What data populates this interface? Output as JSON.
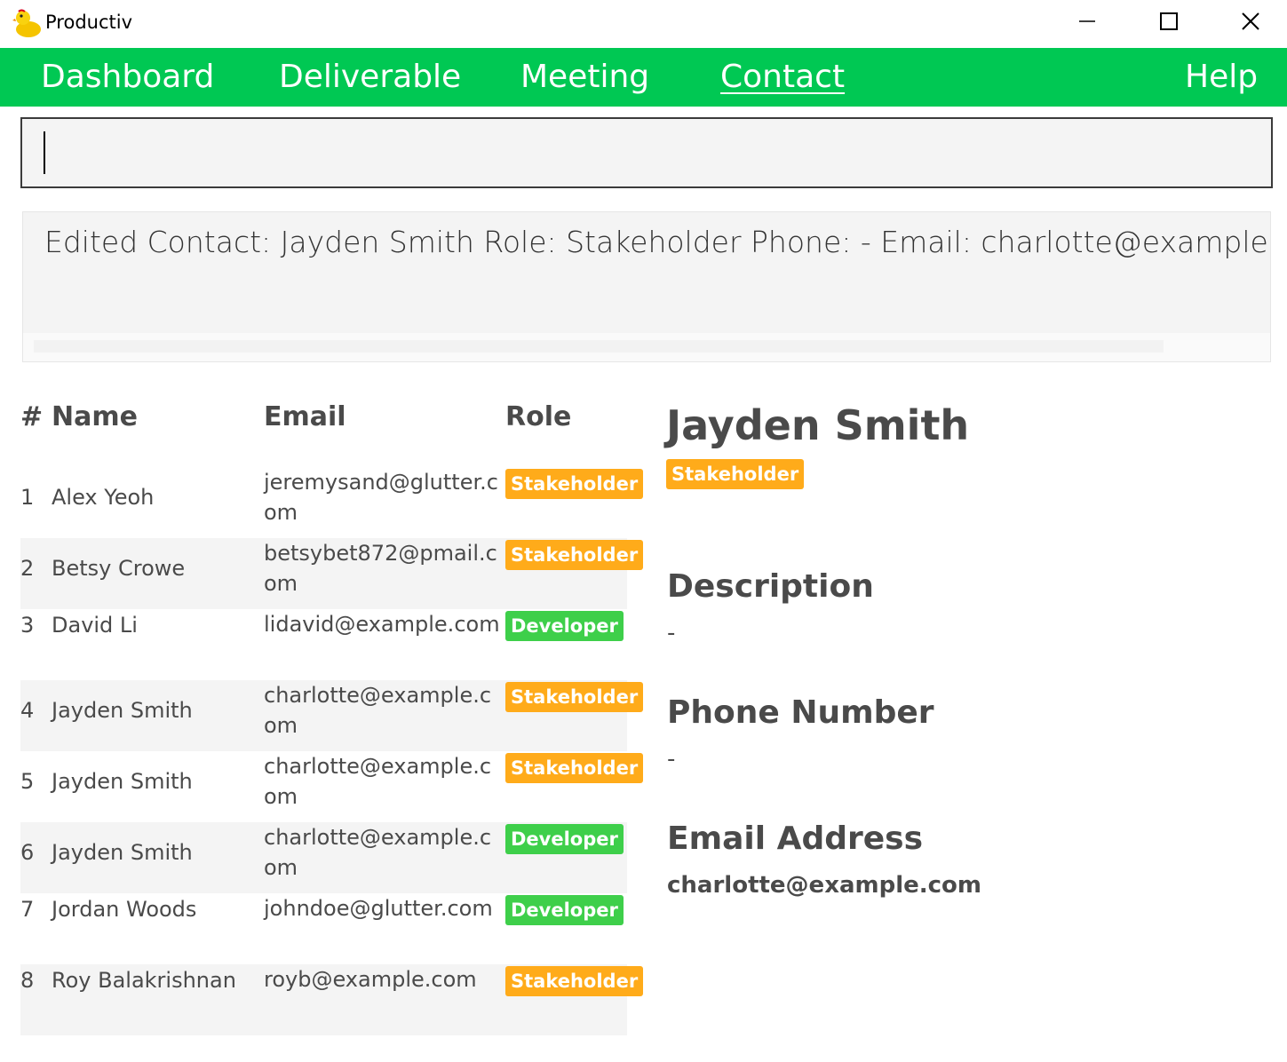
{
  "window": {
    "title": "Productiv",
    "app_icon": "duck-icon",
    "controls": [
      "minimize-icon",
      "maximize-icon",
      "close-icon"
    ]
  },
  "nav": {
    "items": [
      {
        "label": "Dashboard"
      },
      {
        "label": "Deliverable"
      },
      {
        "label": "Meeting"
      },
      {
        "label": "Contact",
        "active": true
      },
      {
        "label": "Help"
      }
    ],
    "color": "#00c853"
  },
  "command": {
    "value": ""
  },
  "result": {
    "text": "Edited Contact: Jayden Smith Role: Stakeholder Phone: - Email: charlotte@example.com Description: -"
  },
  "table": {
    "headers": {
      "index": "#",
      "name": "Name",
      "email": "Email",
      "role": "Role"
    },
    "rows": [
      {
        "index": "1",
        "name": "Alex Yeoh",
        "email": "jeremysand@glutter.com",
        "role": "Stakeholder"
      },
      {
        "index": "2",
        "name": "Betsy Crowe",
        "email": "betsybet872@pmail.com",
        "role": "Stakeholder"
      },
      {
        "index": "3",
        "name": "David Li",
        "email": "lidavid@example.com",
        "role": "Developer"
      },
      {
        "index": "4",
        "name": "Jayden Smith",
        "email": "charlotte@example.com",
        "role": "Stakeholder"
      },
      {
        "index": "5",
        "name": "Jayden Smith",
        "email": "charlotte@example.com",
        "role": "Stakeholder"
      },
      {
        "index": "6",
        "name": "Jayden Smith",
        "email": "charlotte@example.com",
        "role": "Developer"
      },
      {
        "index": "7",
        "name": "Jordan Woods",
        "email": "johndoe@glutter.com",
        "role": "Developer"
      },
      {
        "index": "8",
        "name": "Roy Balakrishnan",
        "email": "royb@example.com",
        "role": "Stakeholder"
      }
    ],
    "role_colors": {
      "Stakeholder": "#ffab1a",
      "Developer": "#3ecf4a"
    }
  },
  "detail": {
    "name": "Jayden Smith",
    "role": "Stakeholder",
    "description_heading": "Description",
    "description": "-",
    "phone_heading": "Phone Number",
    "phone": "-",
    "email_heading": "Email Address",
    "email": "charlotte@example.com"
  }
}
